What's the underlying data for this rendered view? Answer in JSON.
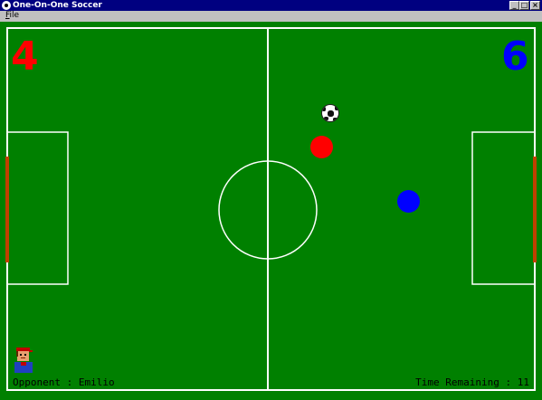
{
  "window": {
    "title": "One-On-One Soccer"
  },
  "titlebar_buttons": {
    "minimize": "_",
    "maximize": "□",
    "close": "×"
  },
  "menu": {
    "file_underlined": "F",
    "file_rest": "ile"
  },
  "scores": {
    "left": "4",
    "right": "6",
    "left_color": "#ff0000",
    "right_color": "#0000ff"
  },
  "footer": {
    "opponent": "Opponent : Emilio",
    "time": "Time Remaining : 11"
  },
  "colors": {
    "field": "#008000",
    "lines": "#ffffff",
    "goal": "#c04000",
    "red_player": "#ff0000",
    "blue_player": "#0000ff"
  },
  "icons": {
    "ball": "soccer-ball-icon",
    "avatar": "opponent-avatar-icon",
    "title": "app-icon"
  }
}
